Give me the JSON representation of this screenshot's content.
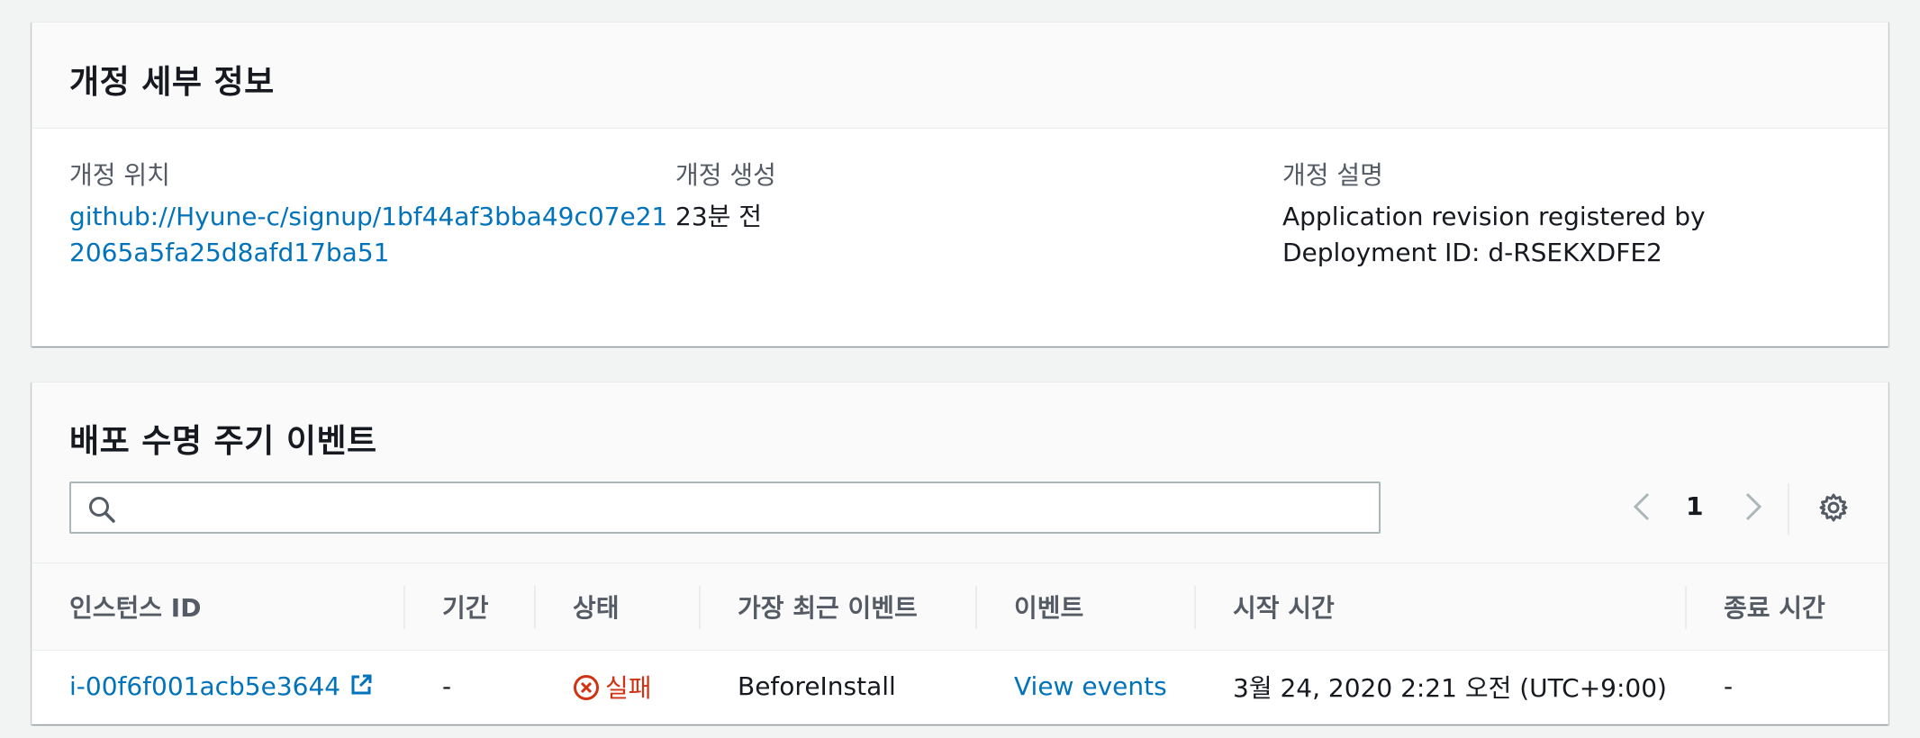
{
  "revision_details": {
    "title": "개정 세부 정보",
    "location_label": "개정 위치",
    "location_value": "github://Hyune-c/signup/1bf44af3bba49c07e212065a5fa25d8afd17ba51",
    "created_label": "개정 생성",
    "created_value": "23분 전",
    "description_label": "개정 설명",
    "description_value": "Application revision registered by Deployment ID: d-RSEKXDFE2"
  },
  "lifecycle_events": {
    "title": "배포 수명 주기 이벤트",
    "search": {
      "value": "",
      "placeholder": ""
    },
    "pagination": {
      "current_page": "1"
    },
    "columns": [
      "인스턴스 ID",
      "기간",
      "상태",
      "가장 최근 이벤트",
      "이벤트",
      "시작 시간",
      "종료 시간"
    ],
    "rows": [
      {
        "instance_id": "i-00f6f001acb5e3644",
        "duration": "-",
        "status": "실패",
        "latest_event": "BeforeInstall",
        "events_link": "View events",
        "start_time": "3월 24, 2020 2:21 오전 (UTC+9:00)",
        "end_time": "-"
      }
    ]
  },
  "colors": {
    "link": "#0073bb",
    "error": "#d13212",
    "label": "#545b64",
    "text": "#16191f",
    "background": "#f2f3f3"
  },
  "icons": [
    "search-icon",
    "chevron-left-icon",
    "chevron-right-icon",
    "gear-icon",
    "error-circle-icon",
    "external-link-icon"
  ]
}
